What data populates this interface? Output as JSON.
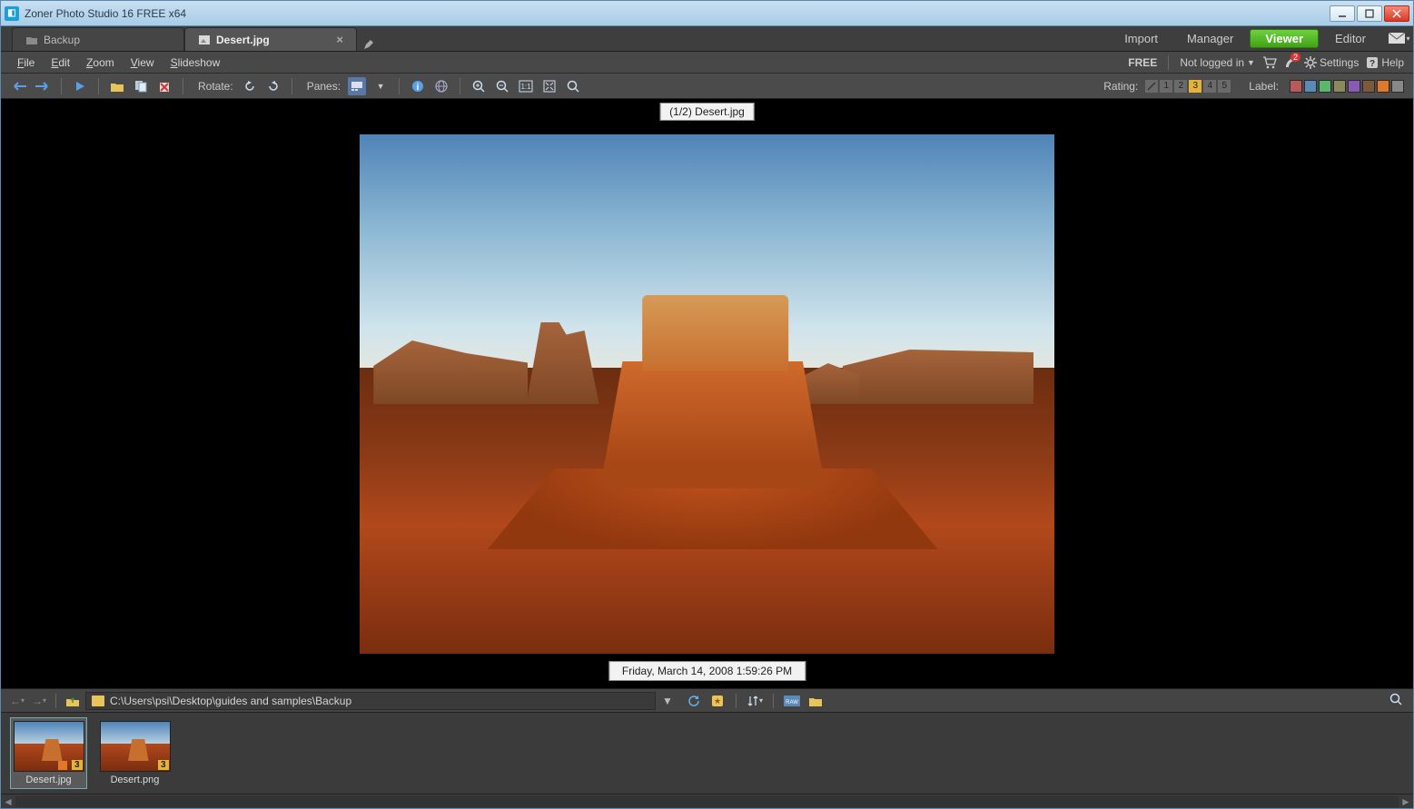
{
  "window": {
    "title": "Zoner Photo Studio 16 FREE x64"
  },
  "tabs": [
    {
      "label": "Backup",
      "active": false
    },
    {
      "label": "Desert.jpg",
      "active": true
    }
  ],
  "modes": {
    "import": "Import",
    "manager": "Manager",
    "viewer": "Viewer",
    "editor": "Editor"
  },
  "menu": {
    "file": "File",
    "edit": "Edit",
    "zoom": "Zoom",
    "view": "View",
    "slideshow": "Slideshow"
  },
  "account": {
    "free_label": "FREE",
    "login_label": "Not logged in",
    "notif_count": "2",
    "settings_label": "Settings",
    "help_label": "Help"
  },
  "toolbar": {
    "rotate_label": "Rotate:",
    "panes_label": "Panes:",
    "rating_label": "Rating:",
    "label_label": "Label:",
    "rating_cells": [
      "1",
      "2",
      "3",
      "4",
      "5"
    ],
    "rating_selected": "3",
    "label_colors": [
      "#b85a5a",
      "#5a8ab8",
      "#5ab86a",
      "#8a8a5a",
      "#8a5ab8",
      "#7a5a3a",
      "#e07a2a",
      "#888888"
    ]
  },
  "image": {
    "caption": "(1/2) Desert.jpg",
    "date": "Friday, March 14, 2008 1:59:26 PM"
  },
  "path": {
    "value": "C:\\Users\\psi\\Desktop\\guides and samples\\Backup"
  },
  "thumbs": [
    {
      "name": "Desert.jpg",
      "rating": "3",
      "selected": true
    },
    {
      "name": "Desert.png",
      "rating": "3",
      "selected": false
    }
  ]
}
